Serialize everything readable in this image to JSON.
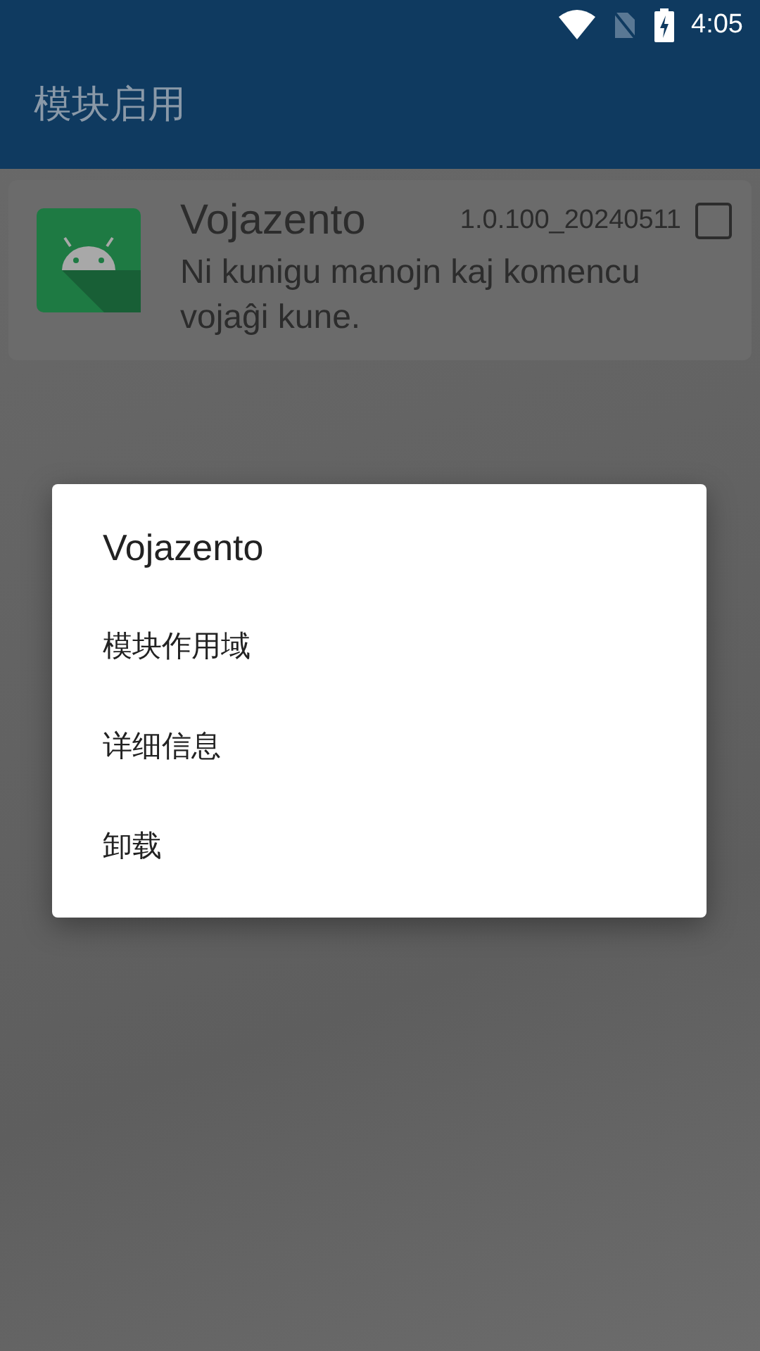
{
  "status_bar": {
    "time": "4:05"
  },
  "app_bar": {
    "title": "模块启用"
  },
  "modules": [
    {
      "name": "Vojazento",
      "version": "1.0.100_20240511",
      "description": "Ni kunigu manojn kaj komencu vojaĝi kune.",
      "checked": false
    }
  ],
  "dialog": {
    "title": "Vojazento",
    "items": [
      "模块作用域",
      "详细信息",
      "卸载"
    ]
  }
}
